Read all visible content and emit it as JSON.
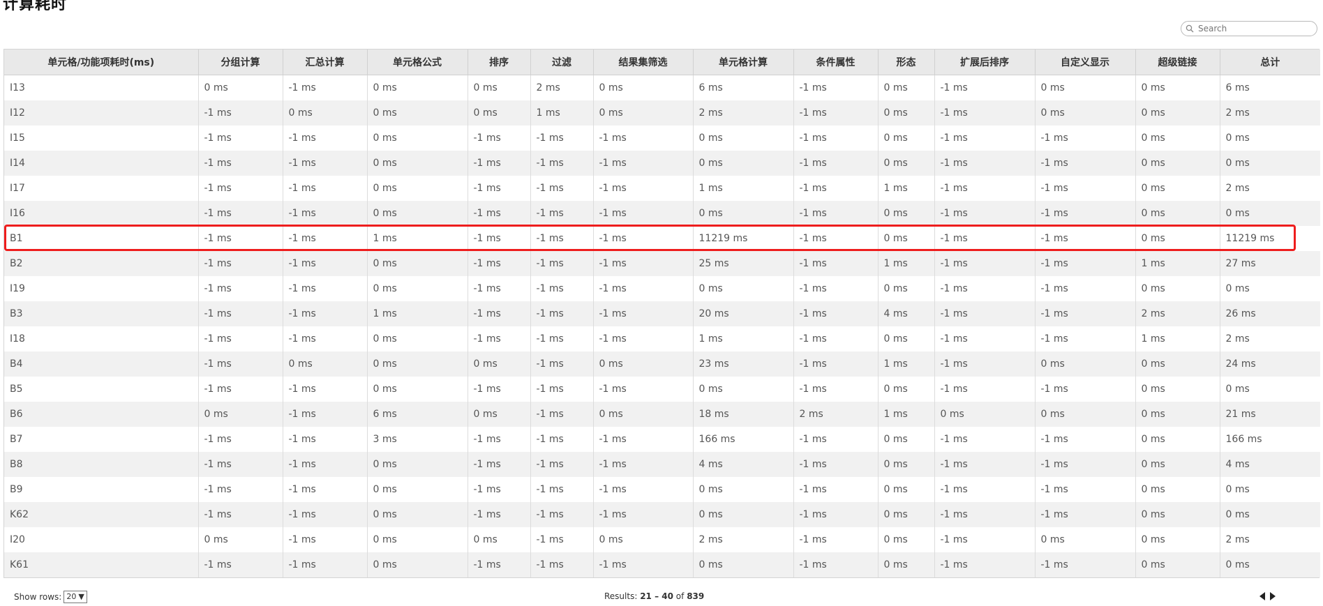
{
  "page": {
    "title": "计算耗时"
  },
  "search": {
    "placeholder": "Search"
  },
  "table": {
    "columns": [
      "单元格/功能项耗时(ms)",
      "分组计算",
      "汇总计算",
      "单元格公式",
      "排序",
      "过滤",
      "结果集筛选",
      "单元格计算",
      "条件属性",
      "形态",
      "扩展后排序",
      "自定义显示",
      "超级链接",
      "总计"
    ],
    "rows": [
      [
        "I13",
        "0 ms",
        "-1 ms",
        "0 ms",
        "0 ms",
        "2 ms",
        "0 ms",
        "6 ms",
        "-1 ms",
        "0 ms",
        "-1 ms",
        "0 ms",
        "0 ms",
        "6 ms"
      ],
      [
        "I12",
        "-1 ms",
        "0 ms",
        "0 ms",
        "0 ms",
        "1 ms",
        "0 ms",
        "2 ms",
        "-1 ms",
        "0 ms",
        "-1 ms",
        "0 ms",
        "0 ms",
        "2 ms"
      ],
      [
        "I15",
        "-1 ms",
        "-1 ms",
        "0 ms",
        "-1 ms",
        "-1 ms",
        "-1 ms",
        "0 ms",
        "-1 ms",
        "0 ms",
        "-1 ms",
        "-1 ms",
        "0 ms",
        "0 ms"
      ],
      [
        "I14",
        "-1 ms",
        "-1 ms",
        "0 ms",
        "-1 ms",
        "-1 ms",
        "-1 ms",
        "0 ms",
        "-1 ms",
        "0 ms",
        "-1 ms",
        "-1 ms",
        "0 ms",
        "0 ms"
      ],
      [
        "I17",
        "-1 ms",
        "-1 ms",
        "0 ms",
        "-1 ms",
        "-1 ms",
        "-1 ms",
        "1 ms",
        "-1 ms",
        "1 ms",
        "-1 ms",
        "-1 ms",
        "0 ms",
        "2 ms"
      ],
      [
        "I16",
        "-1 ms",
        "-1 ms",
        "0 ms",
        "-1 ms",
        "-1 ms",
        "-1 ms",
        "0 ms",
        "-1 ms",
        "0 ms",
        "-1 ms",
        "-1 ms",
        "0 ms",
        "0 ms"
      ],
      [
        "B1",
        "-1 ms",
        "-1 ms",
        "1 ms",
        "-1 ms",
        "-1 ms",
        "-1 ms",
        "11219 ms",
        "-1 ms",
        "0 ms",
        "-1 ms",
        "-1 ms",
        "0 ms",
        "11219 ms"
      ],
      [
        "B2",
        "-1 ms",
        "-1 ms",
        "0 ms",
        "-1 ms",
        "-1 ms",
        "-1 ms",
        "25 ms",
        "-1 ms",
        "1 ms",
        "-1 ms",
        "-1 ms",
        "1 ms",
        "27 ms"
      ],
      [
        "I19",
        "-1 ms",
        "-1 ms",
        "0 ms",
        "-1 ms",
        "-1 ms",
        "-1 ms",
        "0 ms",
        "-1 ms",
        "0 ms",
        "-1 ms",
        "-1 ms",
        "0 ms",
        "0 ms"
      ],
      [
        "B3",
        "-1 ms",
        "-1 ms",
        "1 ms",
        "-1 ms",
        "-1 ms",
        "-1 ms",
        "20 ms",
        "-1 ms",
        "4 ms",
        "-1 ms",
        "-1 ms",
        "2 ms",
        "26 ms"
      ],
      [
        "I18",
        "-1 ms",
        "-1 ms",
        "0 ms",
        "-1 ms",
        "-1 ms",
        "-1 ms",
        "1 ms",
        "-1 ms",
        "0 ms",
        "-1 ms",
        "-1 ms",
        "1 ms",
        "2 ms"
      ],
      [
        "B4",
        "-1 ms",
        "0 ms",
        "0 ms",
        "0 ms",
        "-1 ms",
        "0 ms",
        "23 ms",
        "-1 ms",
        "1 ms",
        "-1 ms",
        "0 ms",
        "0 ms",
        "24 ms"
      ],
      [
        "B5",
        "-1 ms",
        "-1 ms",
        "0 ms",
        "-1 ms",
        "-1 ms",
        "-1 ms",
        "0 ms",
        "-1 ms",
        "0 ms",
        "-1 ms",
        "-1 ms",
        "0 ms",
        "0 ms"
      ],
      [
        "B6",
        "0 ms",
        "-1 ms",
        "6 ms",
        "0 ms",
        "-1 ms",
        "0 ms",
        "18 ms",
        "2 ms",
        "1 ms",
        "0 ms",
        "0 ms",
        "0 ms",
        "21 ms"
      ],
      [
        "B7",
        "-1 ms",
        "-1 ms",
        "3 ms",
        "-1 ms",
        "-1 ms",
        "-1 ms",
        "166 ms",
        "-1 ms",
        "0 ms",
        "-1 ms",
        "-1 ms",
        "0 ms",
        "166 ms"
      ],
      [
        "B8",
        "-1 ms",
        "-1 ms",
        "0 ms",
        "-1 ms",
        "-1 ms",
        "-1 ms",
        "4 ms",
        "-1 ms",
        "0 ms",
        "-1 ms",
        "-1 ms",
        "0 ms",
        "4 ms"
      ],
      [
        "B9",
        "-1 ms",
        "-1 ms",
        "0 ms",
        "-1 ms",
        "-1 ms",
        "-1 ms",
        "0 ms",
        "-1 ms",
        "0 ms",
        "-1 ms",
        "-1 ms",
        "0 ms",
        "0 ms"
      ],
      [
        "K62",
        "-1 ms",
        "-1 ms",
        "0 ms",
        "-1 ms",
        "-1 ms",
        "-1 ms",
        "0 ms",
        "-1 ms",
        "0 ms",
        "-1 ms",
        "-1 ms",
        "0 ms",
        "0 ms"
      ],
      [
        "I20",
        "0 ms",
        "-1 ms",
        "0 ms",
        "0 ms",
        "-1 ms",
        "0 ms",
        "2 ms",
        "-1 ms",
        "0 ms",
        "-1 ms",
        "0 ms",
        "0 ms",
        "2 ms"
      ],
      [
        "K61",
        "-1 ms",
        "-1 ms",
        "0 ms",
        "-1 ms",
        "-1 ms",
        "-1 ms",
        "0 ms",
        "-1 ms",
        "0 ms",
        "-1 ms",
        "-1 ms",
        "0 ms",
        "0 ms"
      ]
    ],
    "highlighted_row": "B1",
    "highlight_color": "#ee1d1d"
  },
  "footer": {
    "show_rows_label": "Show rows:",
    "rows_per_page": "20",
    "results_label": "Results:",
    "range": "21 – 40",
    "of_label": "of",
    "total": "839"
  }
}
